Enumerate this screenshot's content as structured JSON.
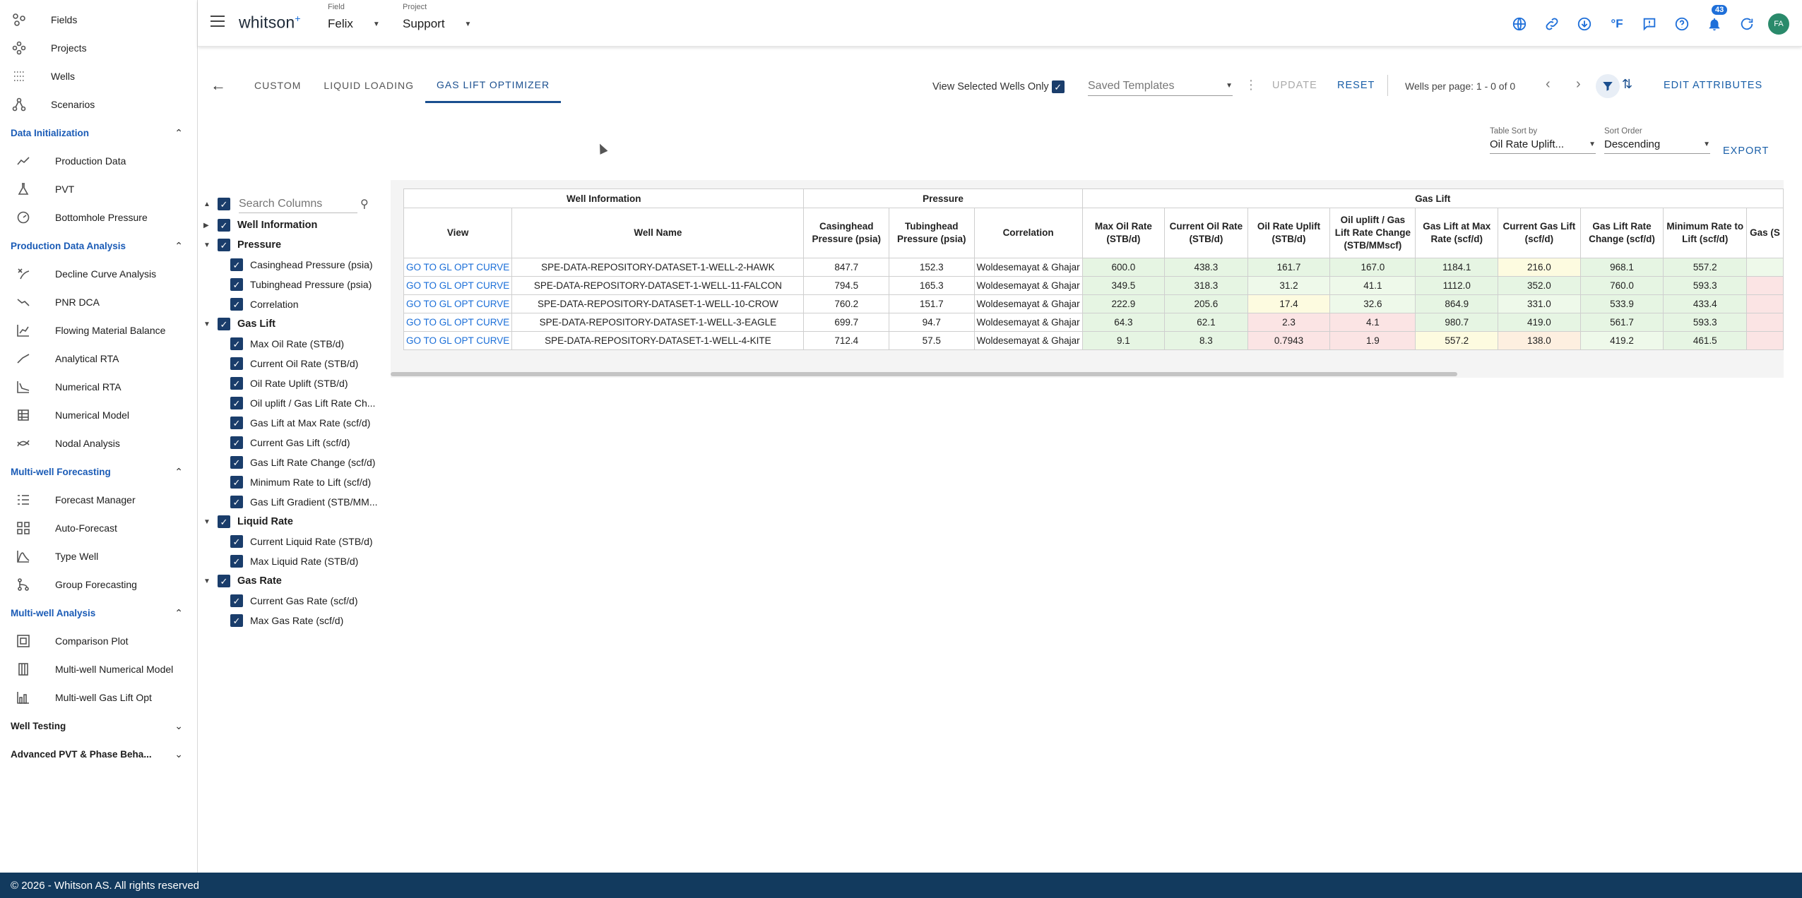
{
  "sidebar": {
    "top_items": [
      {
        "label": "Fields",
        "icon": "fields-icon"
      },
      {
        "label": "Projects",
        "icon": "projects-icon"
      },
      {
        "label": "Wells",
        "icon": "wells-icon"
      },
      {
        "label": "Scenarios",
        "icon": "scenarios-icon"
      }
    ],
    "sections": [
      {
        "label": "Data Initialization",
        "expanded": true,
        "items": [
          {
            "label": "Production Data",
            "icon": "line-chart-icon"
          },
          {
            "label": "PVT",
            "icon": "flask-icon"
          },
          {
            "label": "Bottomhole Pressure",
            "icon": "gauge-icon"
          }
        ]
      },
      {
        "label": "Production Data Analysis",
        "expanded": true,
        "items": [
          {
            "label": "Decline Curve Analysis",
            "icon": "decline-icon"
          },
          {
            "label": "PNR DCA",
            "icon": "trend-down-icon"
          },
          {
            "label": "Flowing Material Balance",
            "icon": "chart-icon"
          },
          {
            "label": "Analytical RTA",
            "icon": "line-icon"
          },
          {
            "label": "Numerical RTA",
            "icon": "step-chart-icon"
          },
          {
            "label": "Numerical Model",
            "icon": "building-icon"
          },
          {
            "label": "Nodal Analysis",
            "icon": "nodal-icon"
          }
        ]
      },
      {
        "label": "Multi-well Forecasting",
        "expanded": true,
        "items": [
          {
            "label": "Forecast Manager",
            "icon": "list-icon"
          },
          {
            "label": "Auto-Forecast",
            "icon": "grid-icon"
          },
          {
            "label": "Type Well",
            "icon": "bell-curve-icon"
          },
          {
            "label": "Group Forecasting",
            "icon": "branch-icon"
          }
        ]
      },
      {
        "label": "Multi-well Analysis",
        "expanded": true,
        "items": [
          {
            "label": "Comparison Plot",
            "icon": "compare-icon"
          },
          {
            "label": "Multi-well Numerical Model",
            "icon": "columns-icon"
          },
          {
            "label": "Multi-well Gas Lift Opt",
            "icon": "chart-bar-icon"
          }
        ]
      },
      {
        "label": "Well Testing",
        "expanded": false,
        "items": []
      },
      {
        "label": "Advanced PVT & Phase Beha...",
        "expanded": false,
        "items": []
      }
    ]
  },
  "header": {
    "logo": "whitson",
    "logo_sup": "+",
    "field_caption": "Field",
    "field_value": "Felix",
    "project_caption": "Project",
    "project_value": "Support",
    "notification_count": "43",
    "avatar_initials": "FA",
    "unit_label": "°F"
  },
  "toolbar": {
    "tabs": [
      "CUSTOM",
      "LIQUID LOADING",
      "GAS LIFT OPTIMIZER"
    ],
    "active_tab": 2,
    "view_selected_label": "View Selected Wells Only",
    "saved_templates_placeholder": "Saved Templates",
    "update_label": "UPDATE",
    "reset_label": "RESET",
    "wells_per_page": "Wells per page: 1 - 0 of 0",
    "edit_attributes_label": "EDIT ATTRIBUTES",
    "table_sort_caption": "Table Sort by",
    "table_sort_value": "Oil Rate Uplift...",
    "sort_order_caption": "Sort Order",
    "sort_order_value": "Descending",
    "export_label": "EXPORT"
  },
  "column_tree": {
    "search_placeholder": "Search Columns",
    "groups": [
      {
        "label": "Well Information",
        "expanded": false,
        "items": []
      },
      {
        "label": "Pressure",
        "expanded": true,
        "items": [
          "Casinghead Pressure (psia)",
          "Tubinghead Pressure (psia)",
          "Correlation"
        ]
      },
      {
        "label": "Gas Lift",
        "expanded": true,
        "items": [
          "Max Oil Rate (STB/d)",
          "Current Oil Rate (STB/d)",
          "Oil Rate Uplift (STB/d)",
          "Oil uplift / Gas Lift Rate Ch...",
          "Gas Lift at Max Rate (scf/d)",
          "Current Gas Lift (scf/d)",
          "Gas Lift Rate Change (scf/d)",
          "Minimum Rate to Lift (scf/d)",
          "Gas Lift Gradient (STB/MM..."
        ]
      },
      {
        "label": "Liquid Rate",
        "expanded": true,
        "items": [
          "Current Liquid Rate (STB/d)",
          "Max Liquid Rate (STB/d)"
        ]
      },
      {
        "label": "Gas Rate",
        "expanded": true,
        "items": [
          "Current Gas Rate (scf/d)",
          "Max Gas Rate (scf/d)"
        ]
      }
    ]
  },
  "table": {
    "group_headers": [
      "Well Information",
      "Pressure",
      "Gas Lift"
    ],
    "columns": [
      "View",
      "Well Name",
      "Casinghead Pressure (psia)",
      "Tubinghead Pressure (psia)",
      "Correlation",
      "Max Oil Rate (STB/d)",
      "Current Oil Rate (STB/d)",
      "Oil Rate Uplift (STB/d)",
      "Oil uplift / Gas Lift Rate Change (STB/MMscf)",
      "Gas Lift at Max Rate (scf/d)",
      "Current Gas Lift (scf/d)",
      "Gas Lift Rate Change (scf/d)",
      "Minimum Rate to Lift (scf/d)",
      "Gas (S"
    ],
    "rows": [
      {
        "view": "GO TO GL OPT CURVE",
        "well": "SPE-DATA-REPOSITORY-DATASET-1-WELL-2-HAWK",
        "chp": "847.7",
        "thp": "152.3",
        "corr": "Woldesemayat & Ghajar",
        "max_oil": "600.0",
        "cur_oil": "438.3",
        "uplift": "161.7",
        "ratio": "167.0",
        "gl_max": "1184.1",
        "cur_gl": "216.0",
        "gl_change": "968.1",
        "min_rate": "557.2"
      },
      {
        "view": "GO TO GL OPT CURVE",
        "well": "SPE-DATA-REPOSITORY-DATASET-1-WELL-11-FALCON",
        "chp": "794.5",
        "thp": "165.3",
        "corr": "Woldesemayat & Ghajar",
        "max_oil": "349.5",
        "cur_oil": "318.3",
        "uplift": "31.2",
        "ratio": "41.1",
        "gl_max": "1112.0",
        "cur_gl": "352.0",
        "gl_change": "760.0",
        "min_rate": "593.3"
      },
      {
        "view": "GO TO GL OPT CURVE",
        "well": "SPE-DATA-REPOSITORY-DATASET-1-WELL-10-CROW",
        "chp": "760.2",
        "thp": "151.7",
        "corr": "Woldesemayat & Ghajar",
        "max_oil": "222.9",
        "cur_oil": "205.6",
        "uplift": "17.4",
        "ratio": "32.6",
        "gl_max": "864.9",
        "cur_gl": "331.0",
        "gl_change": "533.9",
        "min_rate": "433.4"
      },
      {
        "view": "GO TO GL OPT CURVE",
        "well": "SPE-DATA-REPOSITORY-DATASET-1-WELL-3-EAGLE",
        "chp": "699.7",
        "thp": "94.7",
        "corr": "Woldesemayat & Ghajar",
        "max_oil": "64.3",
        "cur_oil": "62.1",
        "uplift": "2.3",
        "ratio": "4.1",
        "gl_max": "980.7",
        "cur_gl": "419.0",
        "gl_change": "561.7",
        "min_rate": "593.3"
      },
      {
        "view": "GO TO GL OPT CURVE",
        "well": "SPE-DATA-REPOSITORY-DATASET-1-WELL-4-KITE",
        "chp": "712.4",
        "thp": "57.5",
        "corr": "Woldesemayat & Ghajar",
        "max_oil": "9.1",
        "cur_oil": "8.3",
        "uplift": "0.7943",
        "ratio": "1.9",
        "gl_max": "557.2",
        "cur_gl": "138.0",
        "gl_change": "419.2",
        "min_rate": "461.5"
      }
    ]
  },
  "footer": {
    "copyright": "© 2026 - Whitson AS. All rights reserved"
  }
}
